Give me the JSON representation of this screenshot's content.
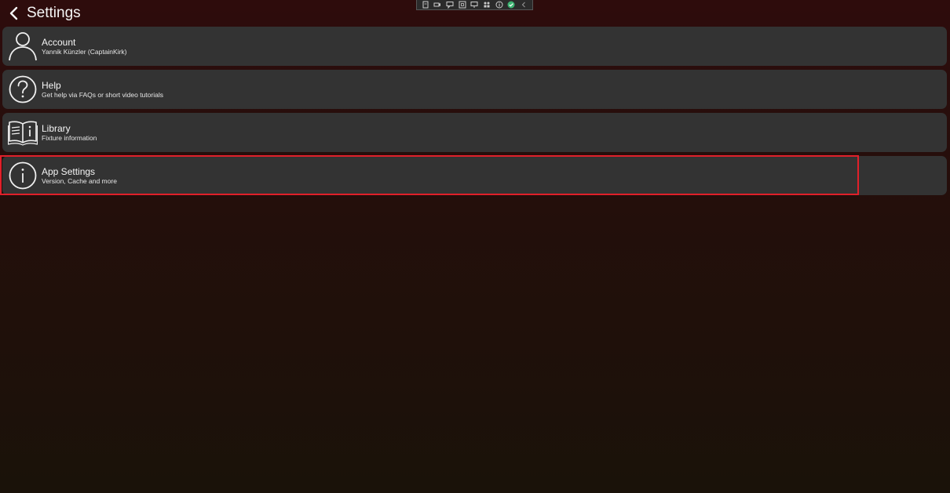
{
  "header": {
    "back_icon": "chevron-left-icon",
    "title": "Settings"
  },
  "toolbar": {
    "icons": [
      "document-icon",
      "camera-icon",
      "chat-icon",
      "frame-icon",
      "monitor-icon",
      "group-icon",
      "info-circle-icon",
      "check-circle-icon",
      "chevron-left-icon"
    ],
    "check_color": "#3cb371"
  },
  "items": [
    {
      "icon": "person-icon",
      "title": "Account",
      "subtitle": "Yannik Künzler (CaptainKirk)"
    },
    {
      "icon": "question-circle-icon",
      "title": "Help",
      "subtitle": "Get help via FAQs or short video tutorials"
    },
    {
      "icon": "book-info-icon",
      "title": "Library",
      "subtitle": "Fixture information"
    },
    {
      "icon": "info-circle-icon",
      "title": "App Settings",
      "subtitle": "Version, Cache and more"
    }
  ],
  "colors": {
    "card": "#333333",
    "highlight": "#e0202a",
    "background_top": "#2e0c0c",
    "background_bottom": "#1a1209"
  }
}
